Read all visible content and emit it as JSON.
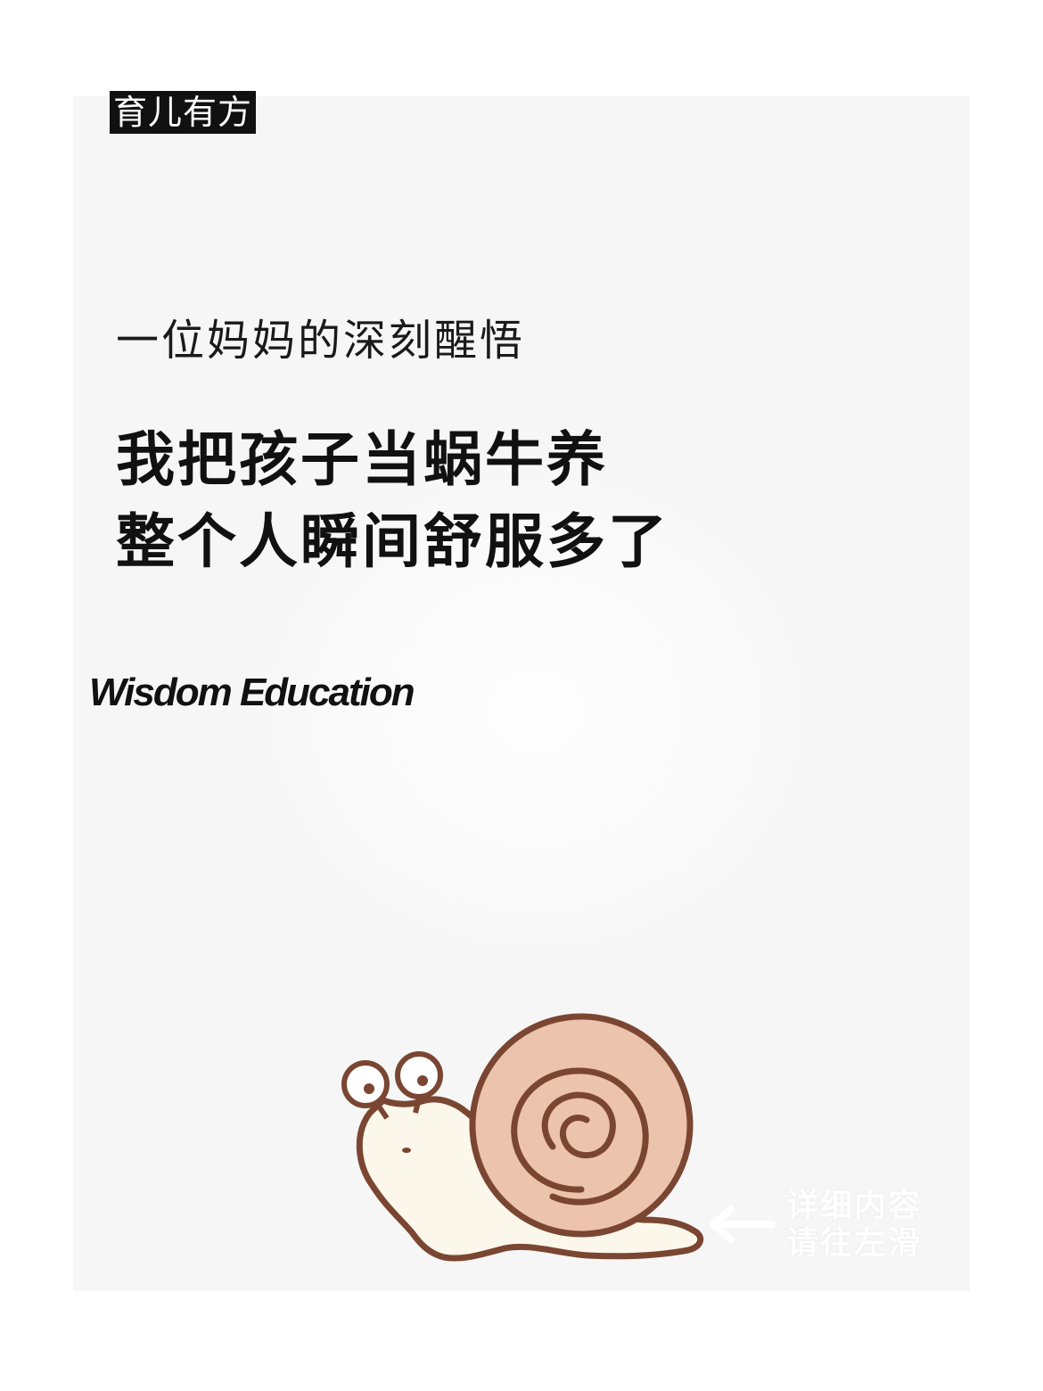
{
  "tag": "育儿有方",
  "subtitle": "一位妈妈的深刻醒悟",
  "headline": {
    "line1": "我把孩子当蜗牛养",
    "line2": "整个人瞬间舒服多了"
  },
  "brand": "Wisdom Education",
  "swipe_hint": {
    "line1": "详细内容",
    "line2": "请往左滑",
    "icon": "arrow-left-icon"
  },
  "illustration": {
    "icon": "snail-icon",
    "outline_color": "#7a4632",
    "shell_color": "#ecc4ad",
    "body_color": "#fbf7ea"
  },
  "colors": {
    "card_background": "#f6f6f6",
    "tag_background": "#111111",
    "text": "#111111"
  }
}
